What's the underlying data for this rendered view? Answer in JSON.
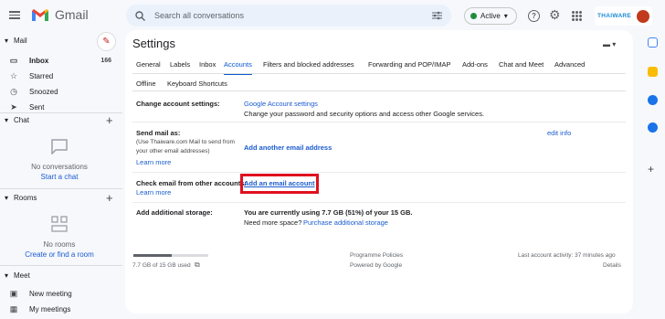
{
  "header": {
    "logo": "Gmail",
    "search_placeholder": "Search all conversations",
    "status": "Active",
    "help": "?",
    "brand": "THAIWARE"
  },
  "nav": {
    "mail_section": "Mail",
    "items": [
      {
        "label": "Inbox",
        "count": "166"
      },
      {
        "label": "Starred"
      },
      {
        "label": "Snoozed"
      },
      {
        "label": "Sent"
      }
    ],
    "chat_section": "Chat",
    "chat_empty": "No conversations",
    "chat_link": "Start a chat",
    "rooms_section": "Rooms",
    "rooms_empty": "No rooms",
    "rooms_link": "Create or find a room",
    "meet_section": "Meet",
    "meet_items": [
      "New meeting",
      "My meetings"
    ]
  },
  "settings": {
    "title": "Settings",
    "tabs": [
      "General",
      "Labels",
      "Inbox",
      "Accounts",
      "Filters and blocked addresses",
      "Forwarding and POP/IMAP",
      "Add-ons",
      "Chat and Meet",
      "Advanced"
    ],
    "tabs_row2": [
      "Offline",
      "Keyboard Shortcuts"
    ],
    "rows": {
      "change_label": "Change account settings:",
      "change_link": "Google Account settings",
      "change_desc": "Change your password and security options and access other Google services.",
      "send_label": "Send mail as:",
      "send_help1": "(Use Thaiware.com Mail to send from",
      "send_help2": "your other email addresses)",
      "send_learn": "Learn more",
      "send_link": "Add another email address",
      "send_edit": "edit info",
      "check_label": "Check email from other accounts:",
      "check_learn": "Learn more",
      "check_link": "Add an email account",
      "storage_label": "Add additional storage:",
      "storage_val": "You are currently using 7.7 GB (51%) of your 15 GB.",
      "storage_need": "Need more space?",
      "storage_link": "Purchase additional storage"
    },
    "footer": {
      "usage": "7.7 GB of 15 GB used",
      "policies": "Programme Policies",
      "powered": "Powered by Google",
      "activity": "Last account activity: 37 minutes ago",
      "details": "Details"
    }
  },
  "colors": {
    "accent": "#0b57d0",
    "highlight": "#e0101f"
  }
}
